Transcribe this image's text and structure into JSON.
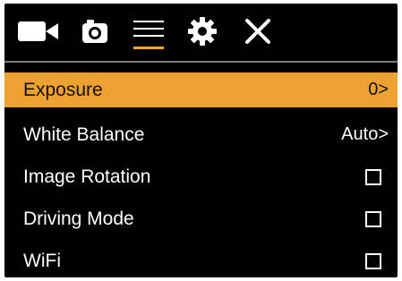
{
  "top_tabs": [
    {
      "icon": "video-camera-icon"
    },
    {
      "icon": "photo-camera-icon"
    },
    {
      "icon": "menu-icon",
      "active": true
    },
    {
      "icon": "gear-icon"
    },
    {
      "icon": "close-icon"
    }
  ],
  "colors": {
    "accent": "#eda130",
    "background": "#000000",
    "text": "#ffffff"
  },
  "menu": {
    "items": [
      {
        "label": "Exposure",
        "value": "0>",
        "selected": true
      },
      {
        "label": "White Balance",
        "value": "Auto>"
      },
      {
        "label": "Image Rotation",
        "checked": false
      },
      {
        "label": "Driving Mode",
        "checked": false
      },
      {
        "label": "WiFi",
        "checked": false
      }
    ]
  }
}
